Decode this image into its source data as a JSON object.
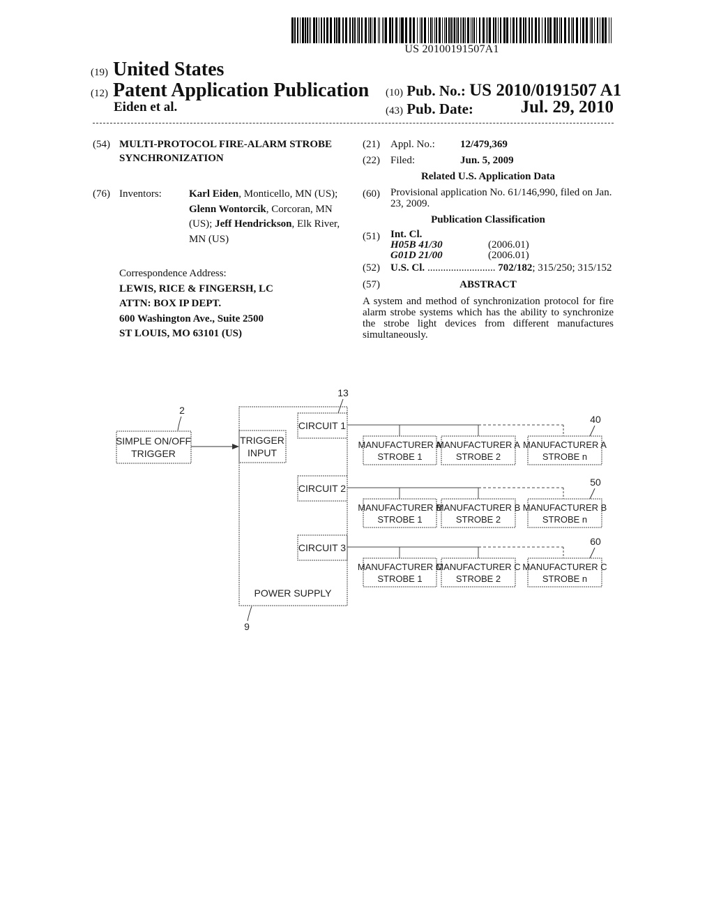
{
  "header": {
    "barcode_number": "US 20100191507A1",
    "country_code": "(19)",
    "country": "United States",
    "type_code": "(12)",
    "type": "Patent Application Publication",
    "authors": "Eiden et al.",
    "pub_no_code": "(10)",
    "pub_no_label": "Pub. No.:",
    "pub_no_value": "US 2010/0191507 A1",
    "pub_date_code": "(43)",
    "pub_date_label": "Pub. Date:",
    "pub_date_value": "Jul. 29, 2010"
  },
  "left": {
    "title_code": "(54)",
    "title_line1": "MULTI-PROTOCOL FIRE-ALARM STROBE",
    "title_line2": "SYNCHRONIZATION",
    "inventors_code": "(76)",
    "inventors_label": "Inventors:",
    "inventors": [
      {
        "name": "Karl Eiden",
        "location": ", Monticello, MN (US);"
      },
      {
        "name": "Glenn Wontorcik",
        "location": ", Corcoran, MN"
      },
      {
        "prefix": "(US); ",
        "name": "Jeff Hendrickson",
        "location": ", Elk River,"
      },
      {
        "location": "MN (US)"
      }
    ],
    "correspondence_label": "Correspondence Address:",
    "correspondence_lines": [
      "LEWIS, RICE & FINGERSH, LC",
      "ATTN: BOX IP DEPT.",
      "600 Washington Ave., Suite 2500",
      "ST LOUIS, MO 63101 (US)"
    ]
  },
  "right": {
    "appl_code": "(21)",
    "appl_label": "Appl. No.:",
    "appl_value": "12/479,369",
    "filed_code": "(22)",
    "filed_label": "Filed:",
    "filed_value": "Jun. 5, 2009",
    "related_heading": "Related U.S. Application Data",
    "provisional_code": "(60)",
    "provisional_line1": "Provisional application No. 61/146,990, filed on Jan.",
    "provisional_line2": "23, 2009.",
    "classification_heading": "Publication Classification",
    "intcl_code": "(51)",
    "intcl_label": "Int. Cl.",
    "intcl_entries": [
      {
        "class": "H05B 41/30",
        "version": "(2006.01)"
      },
      {
        "class": "G01D 21/00",
        "version": "(2006.01)"
      }
    ],
    "uscl_code": "(52)",
    "uscl_label": "U.S. Cl.",
    "uscl_dots": "..........................",
    "uscl_primary": "702/182",
    "uscl_rest": "; 315/250; 315/152",
    "abstract_code": "(57)",
    "abstract_heading": "ABSTRACT",
    "abstract_text": "A system and method of synchronization protocol for fire alarm strobe systems which has the ability to synchronize the strobe light devices from different manufactures simultaneously."
  },
  "figure": {
    "trigger": {
      "ref": "2",
      "line1": "SIMPLE ON/OFF",
      "line2": "TRIGGER"
    },
    "trigger_input": {
      "line1": "TRIGGER",
      "line2": "INPUT"
    },
    "power_supply": {
      "ref": "9",
      "label": "POWER SUPPLY"
    },
    "circuits_ref": "13",
    "rows": [
      {
        "circuit": "CIRCUIT 1",
        "ref": "40",
        "strobes": [
          {
            "line1": "MANUFACTURER A",
            "line2": "STROBE 1"
          },
          {
            "line1": "MANUFACTURER A",
            "line2": "STROBE 2"
          },
          {
            "line1": "MANUFACTURER A",
            "line2": "STROBE n"
          }
        ]
      },
      {
        "circuit": "CIRCUIT 2",
        "ref": "50",
        "strobes": [
          {
            "line1": "MANUFACTURER B",
            "line2": "STROBE 1"
          },
          {
            "line1": "MANUFACTURER B",
            "line2": "STROBE 2"
          },
          {
            "line1": "MANUFACTURER B",
            "line2": "STROBE n"
          }
        ]
      },
      {
        "circuit": "CIRCUIT 3",
        "ref": "60",
        "strobes": [
          {
            "line1": "MANUFACTURER C",
            "line2": "STROBE 1"
          },
          {
            "line1": "MANUFACTURER C",
            "line2": "STROBE 2"
          },
          {
            "line1": "MANUFACTURER C",
            "line2": "STROBE n"
          }
        ]
      }
    ]
  }
}
